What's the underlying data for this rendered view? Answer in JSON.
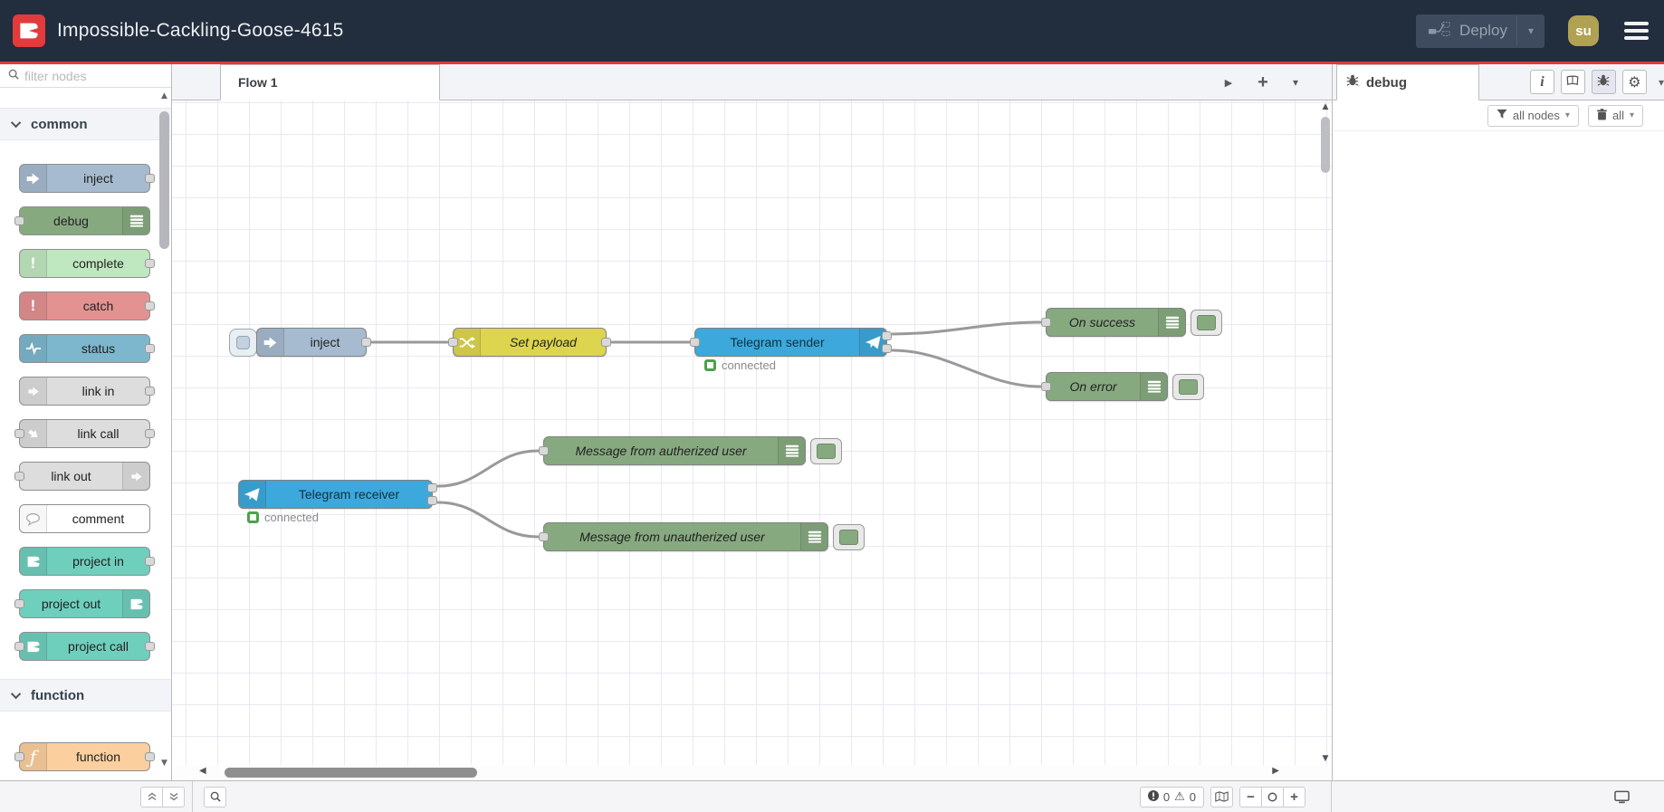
{
  "colors": {
    "header_bg": "#222d3d",
    "accent_red": "#dd3b3b",
    "node_inject": "#a6bbcf",
    "node_debug": "#87a980",
    "node_complete": "#c0e8c0",
    "node_catch": "#e49191",
    "node_status": "#7db7cd",
    "node_link": "#dddddd",
    "node_comment": "#ffffff",
    "node_project": "#6fcfbd",
    "node_function": "#fbcf9e",
    "node_change": "#ddd54e",
    "node_telegram": "#3da8db",
    "wire": "#999999"
  },
  "icons": {
    "plus": "+",
    "caret_down": "▾",
    "triangle_right": "▶",
    "triangle_left": "◀",
    "triangle_up": "▲",
    "triangle_down": "▼",
    "warning": "⚠",
    "gear": "⚙",
    "info": "i",
    "function_f": "ƒ",
    "exclamation": "!"
  },
  "header": {
    "title": "Impossible-Cackling-Goose-4615",
    "deploy_label": "Deploy",
    "user_initials": "su"
  },
  "palette": {
    "filter_placeholder": "filter nodes",
    "categories": [
      {
        "label": "common",
        "nodes": [
          {
            "label": "inject"
          },
          {
            "label": "debug"
          },
          {
            "label": "complete"
          },
          {
            "label": "catch"
          },
          {
            "label": "status"
          },
          {
            "label": "link in"
          },
          {
            "label": "link call"
          },
          {
            "label": "link out"
          },
          {
            "label": "comment"
          },
          {
            "label": "project in"
          },
          {
            "label": "project out"
          },
          {
            "label": "project call"
          }
        ]
      },
      {
        "label": "function",
        "nodes": [
          {
            "label": "function"
          }
        ]
      }
    ]
  },
  "workspace": {
    "tabs": [
      {
        "label": "Flow 1"
      }
    ]
  },
  "flow": {
    "nodes": [
      {
        "id": "inject",
        "label": "inject"
      },
      {
        "id": "set-payload",
        "label": "Set payload"
      },
      {
        "id": "telegram-sender",
        "label": "Telegram sender",
        "status": "connected"
      },
      {
        "id": "on-success",
        "label": "On success"
      },
      {
        "id": "on-error",
        "label": "On error"
      },
      {
        "id": "telegram-receiver",
        "label": "Telegram receiver",
        "status": "connected"
      },
      {
        "id": "msg-authorized",
        "label": "Message from autherized user"
      },
      {
        "id": "msg-unauthorized",
        "label": "Message from unautherized user"
      }
    ]
  },
  "sidebar": {
    "tab_label": "debug",
    "filter_button_label": "all nodes",
    "clear_button_label": "all"
  },
  "footer": {
    "errors": "0",
    "warnings": "0"
  }
}
